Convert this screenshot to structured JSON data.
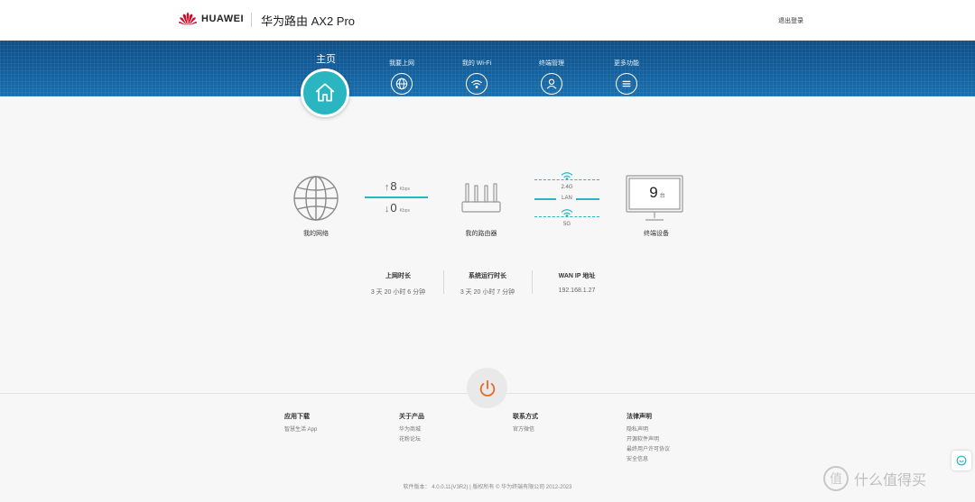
{
  "header": {
    "brand": "HUAWEI",
    "product": "华为路由 AX2 Pro",
    "logout": "退出登录"
  },
  "nav": {
    "home": "主页",
    "items": [
      {
        "label": "我要上网",
        "icon": "globe-icon"
      },
      {
        "label": "我的 Wi-Fi",
        "icon": "wifi-icon"
      },
      {
        "label": "终端管理",
        "icon": "user-icon"
      },
      {
        "label": "更多功能",
        "icon": "menu-icon"
      }
    ]
  },
  "status": {
    "network_label": "我的网络",
    "upload": "8",
    "upload_unit": "Kbps",
    "download": "0",
    "download_unit": "Kbps",
    "router_label": "我的路由器",
    "band_24": "2.4G",
    "band_lan": "LAN",
    "band_5": "5G",
    "devices_count": "9",
    "devices_unit": "台",
    "devices_label": "终端设备"
  },
  "stats": [
    {
      "title": "上网时长",
      "value": "3 天 20 小时 6 分钟"
    },
    {
      "title": "系统运行时长",
      "value": "3 天 20 小时 7 分钟"
    },
    {
      "title": "WAN IP 地址",
      "value": "192.168.1.27"
    }
  ],
  "footer": {
    "columns": [
      {
        "title": "应用下载",
        "links": [
          "智慧生活 App"
        ]
      },
      {
        "title": "关于产品",
        "links": [
          "华为商城",
          "花粉论坛"
        ]
      },
      {
        "title": "联系方式",
        "links": [
          "官方微信"
        ]
      },
      {
        "title": "法律声明",
        "links": [
          "隐私声明",
          "开源软件声明",
          "最终用户许可协议",
          "安全信息"
        ]
      }
    ],
    "copyright": "软件版本： 4.0.0.11(V3R2)  |  版权所有 © 华为终端有限公司 2012-2023"
  },
  "watermark": {
    "badge": "值",
    "text": "什么值得买"
  },
  "colors": {
    "accent": "#2ab6c0",
    "nav_bg": "#14609d",
    "power": "#e8692a",
    "brand_red": "#cf0a2c"
  }
}
